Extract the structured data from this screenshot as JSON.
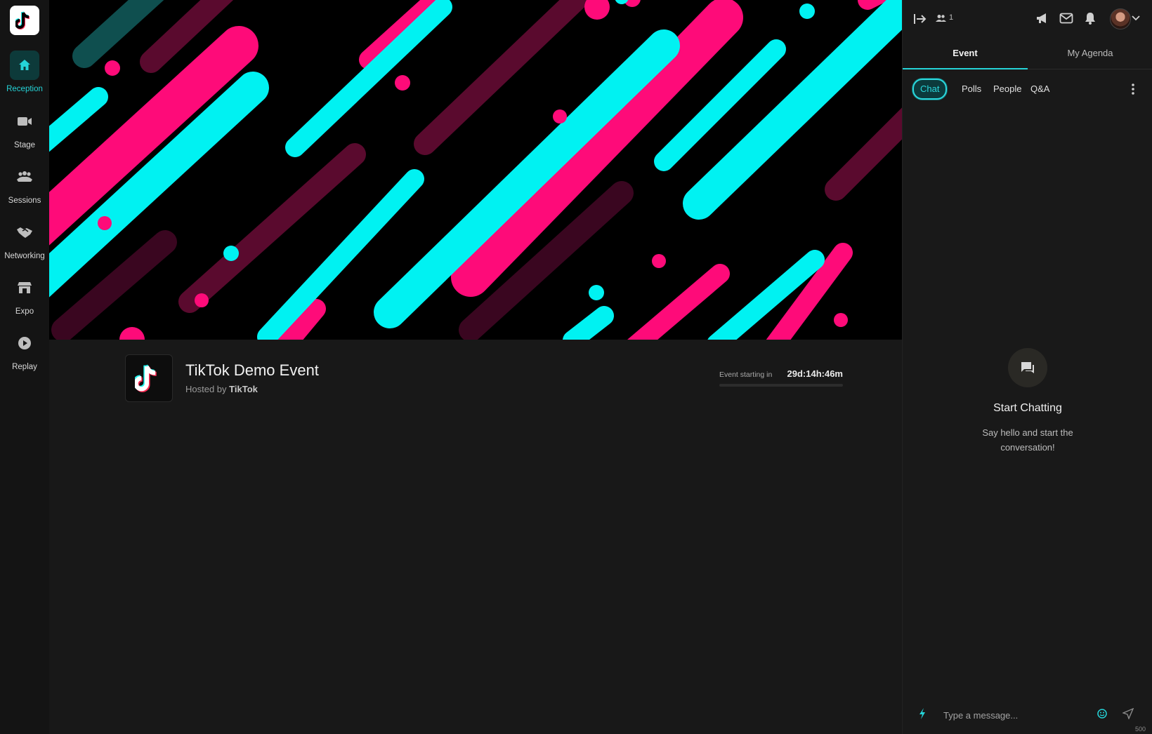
{
  "app": {
    "accent_color": "#25d4d8",
    "brand_pink": "#fe0b79",
    "brand_cyan": "#00f2f2"
  },
  "sidebar": {
    "logo_icon": "tiktok-logo-icon",
    "items": [
      {
        "label": "Reception",
        "icon": "home-icon",
        "active": true
      },
      {
        "label": "Stage",
        "icon": "video-camera-icon",
        "active": false
      },
      {
        "label": "Sessions",
        "icon": "people-group-icon",
        "active": false
      },
      {
        "label": "Networking",
        "icon": "handshake-icon",
        "active": false
      },
      {
        "label": "Expo",
        "icon": "storefront-icon",
        "active": false
      },
      {
        "label": "Replay",
        "icon": "play-circle-icon",
        "active": false
      }
    ]
  },
  "event": {
    "title": "TikTok Demo Event",
    "hosted_by_prefix": "Hosted by",
    "host_name": "TikTok",
    "countdown_label": "Event starting in",
    "countdown_value": "29d:14h:46m"
  },
  "panel": {
    "attendee_count": "1",
    "tabs": [
      {
        "label": "Event",
        "active": true
      },
      {
        "label": "My Agenda",
        "active": false
      }
    ],
    "subtabs": [
      {
        "label": "Chat",
        "active": true
      },
      {
        "label": "Polls",
        "active": false
      },
      {
        "label": "People",
        "active": false
      },
      {
        "label": "Q&A",
        "active": false
      }
    ],
    "empty_title": "Start Chatting",
    "empty_subtitle": "Say hello and start the conversation!",
    "message_placeholder": "Type a message...",
    "char_limit": "500"
  }
}
